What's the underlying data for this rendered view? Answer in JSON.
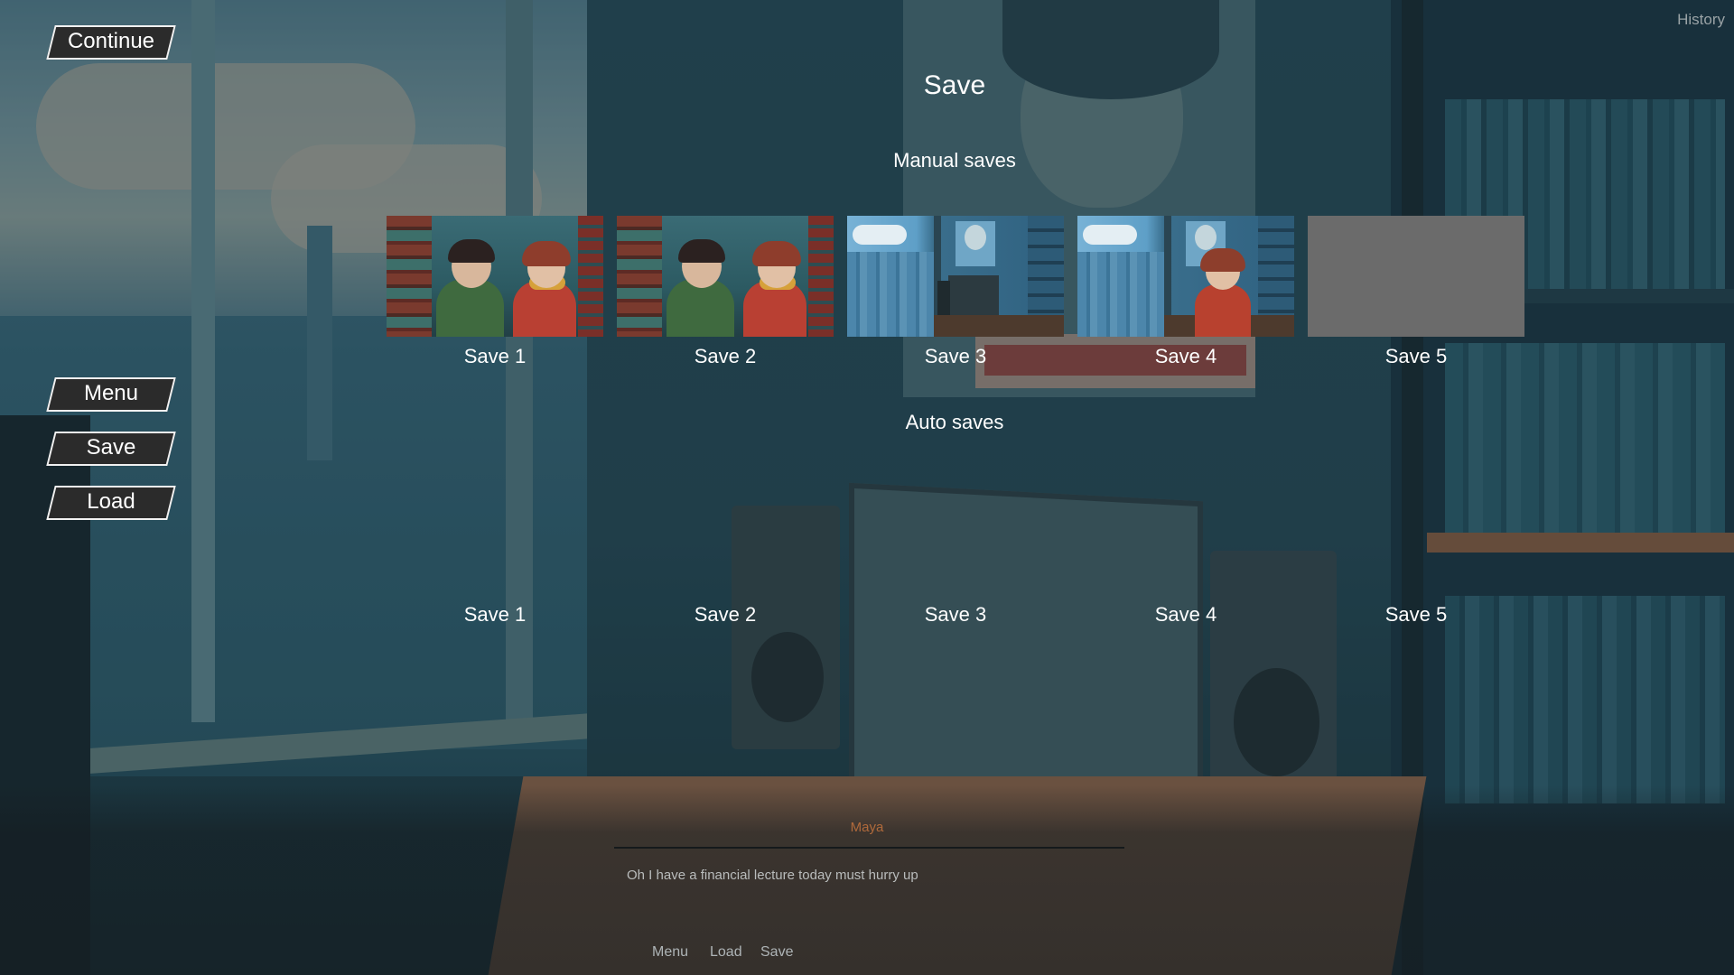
{
  "side_menu": {
    "continue": "Continue",
    "menu": "Menu",
    "save": "Save",
    "load": "Load"
  },
  "history": "History",
  "save_screen": {
    "title": "Save",
    "manual_title": "Manual saves",
    "auto_title": "Auto saves",
    "manual_slots": [
      {
        "label": "Save 1",
        "thumbnail": "classroom-two-characters"
      },
      {
        "label": "Save 2",
        "thumbnail": "classroom-two-characters"
      },
      {
        "label": "Save 3",
        "thumbnail": "room-desk-window"
      },
      {
        "label": "Save 4",
        "thumbnail": "room-girl-window"
      },
      {
        "label": "Save 5",
        "thumbnail": "empty"
      }
    ],
    "auto_slots": [
      {
        "label": "Save 1"
      },
      {
        "label": "Save 2"
      },
      {
        "label": "Save 3"
      },
      {
        "label": "Save 4"
      },
      {
        "label": "Save 5"
      }
    ]
  },
  "dialogue": {
    "speaker": "Maya",
    "text": "Oh I have a financial lecture today must hurry up"
  },
  "quick_menu": {
    "menu": "Menu",
    "load": "Load",
    "save": "Save"
  },
  "colors": {
    "button_fill": "#2b2b2b",
    "button_border": "#f1f1f1",
    "speaker_name": "#b06a3b",
    "empty_slot": "#6b6b6b"
  }
}
